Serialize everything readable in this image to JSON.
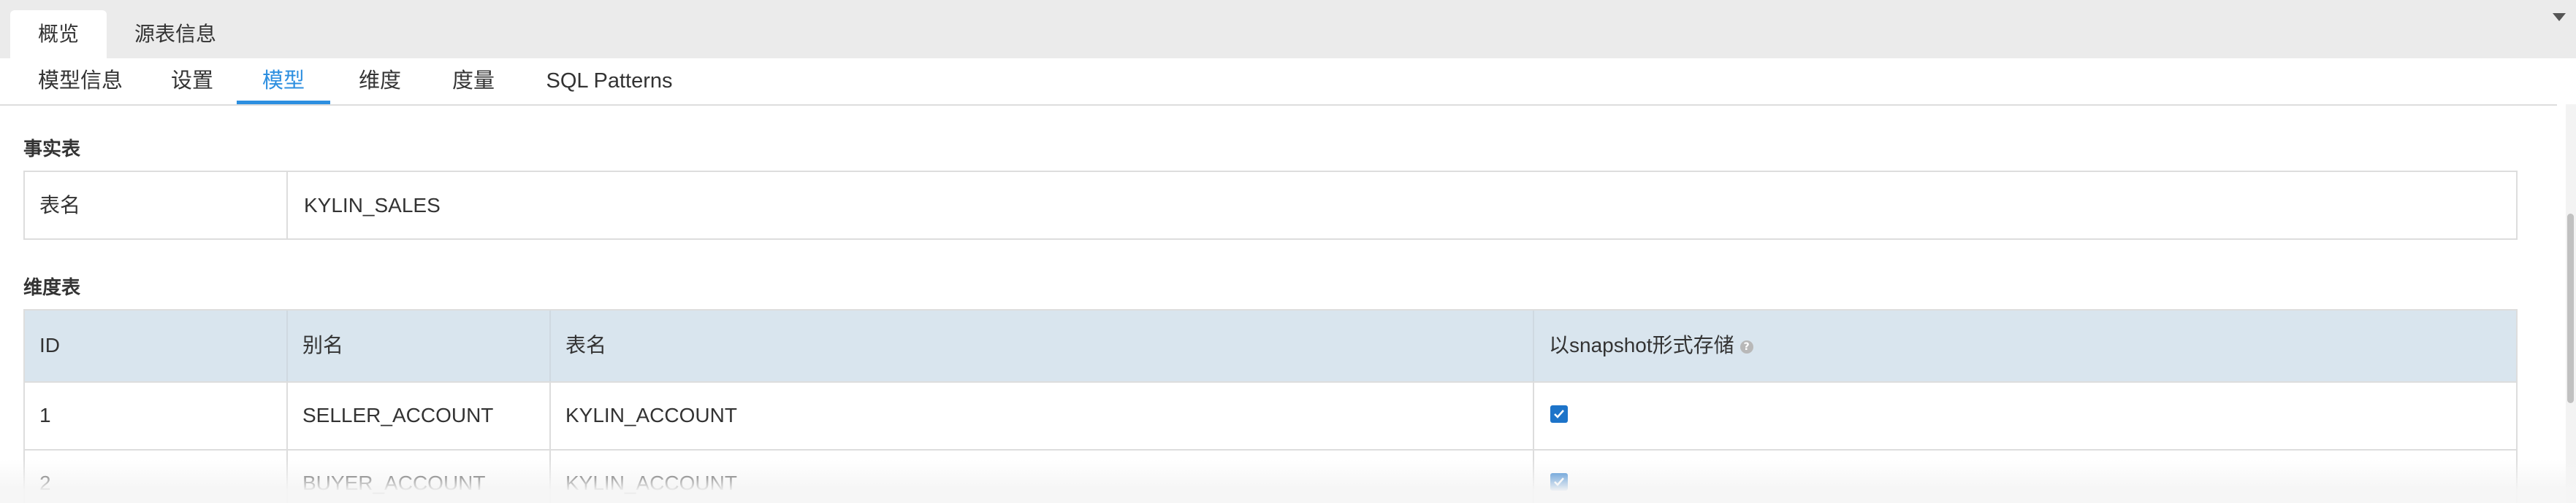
{
  "top_tabs": [
    {
      "label": "概览",
      "active": true
    },
    {
      "label": "源表信息",
      "active": false
    }
  ],
  "sub_tabs": [
    {
      "label": "模型信息"
    },
    {
      "label": "设置"
    },
    {
      "label": "模型",
      "active": true
    },
    {
      "label": "维度"
    },
    {
      "label": "度量"
    },
    {
      "label": "SQL Patterns"
    }
  ],
  "fact_section": {
    "title": "事实表",
    "label": "表名",
    "value": "KYLIN_SALES"
  },
  "dim_section": {
    "title": "维度表",
    "headers": {
      "id": "ID",
      "alias": "别名",
      "table": "表名",
      "snapshot": "以snapshot形式存储"
    },
    "rows": [
      {
        "id": "1",
        "alias": "SELLER_ACCOUNT",
        "table": "KYLIN_ACCOUNT",
        "snapshot": true
      },
      {
        "id": "2",
        "alias": "BUYER_ACCOUNT",
        "table": "KYLIN_ACCOUNT",
        "snapshot": true
      }
    ]
  },
  "colors": {
    "accent": "#2d8fe0",
    "header_bg": "#d9e5ee",
    "checkbox": "#1d74c9"
  }
}
